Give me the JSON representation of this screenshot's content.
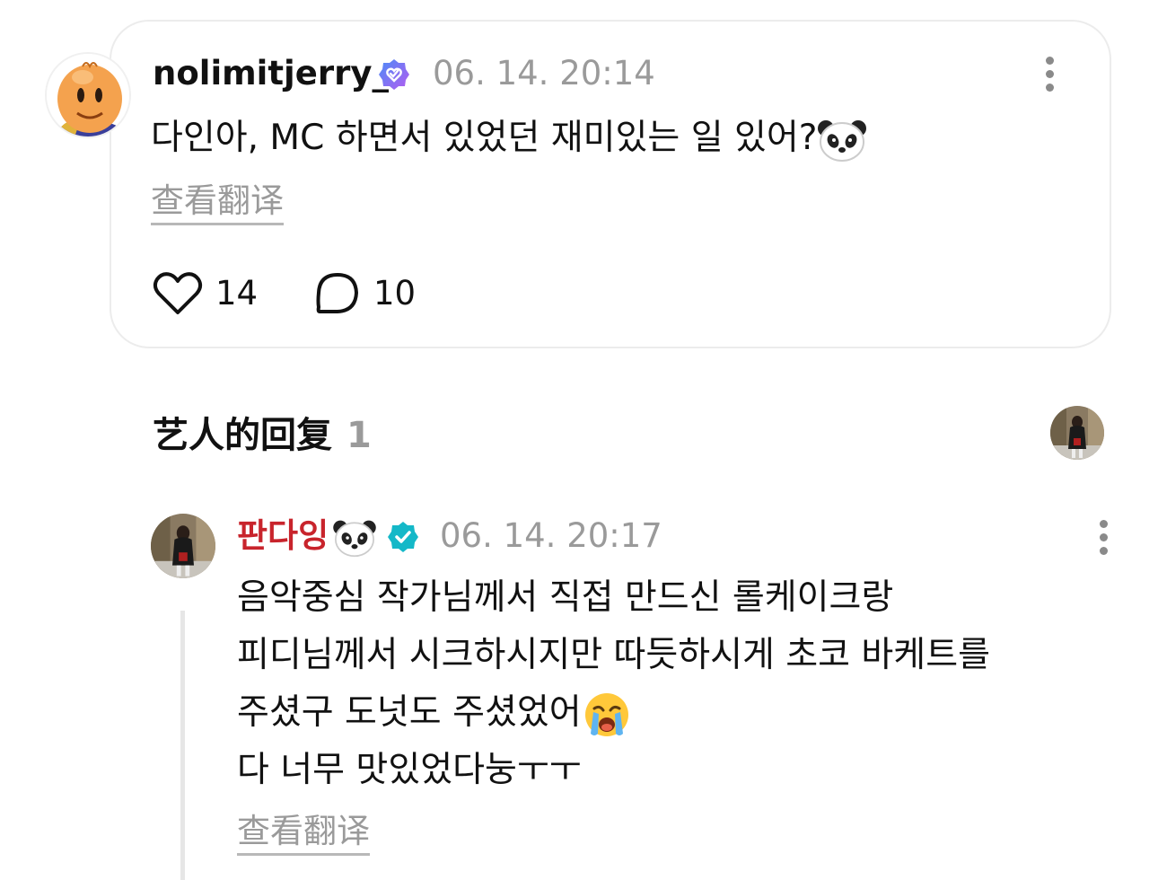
{
  "fan_post": {
    "username": "nolimitjerry_",
    "timestamp": "06. 14. 20:14",
    "text": "다인아, MC 하면서 있었던 재미있는 일 있어?",
    "trailing_emoji": "panda-face",
    "translate_label": "查看翻译",
    "like_count": "14",
    "reply_count": "10",
    "verified_badge_color": "#7b6cf6"
  },
  "artist_section": {
    "title": "艺人的回复",
    "count": "1"
  },
  "artist_reply": {
    "username": "판다잉",
    "name_emoji": "panda-face",
    "name_color": "#c8242c",
    "timestamp": "06. 14. 20:17",
    "lines": [
      "음악중심 작가님께서 직접 만드신 롤케이크랑",
      "피디님께서 시크하시지만 따듯하시게 초코 바케트를",
      "주셨구 도넛도 주셨었어",
      "다 너무 맛있었다눙ㅜㅜ"
    ],
    "line3_emoji": "loudly-crying-face",
    "translate_label": "查看翻译",
    "verified_badge_color": "#14b8c8"
  }
}
